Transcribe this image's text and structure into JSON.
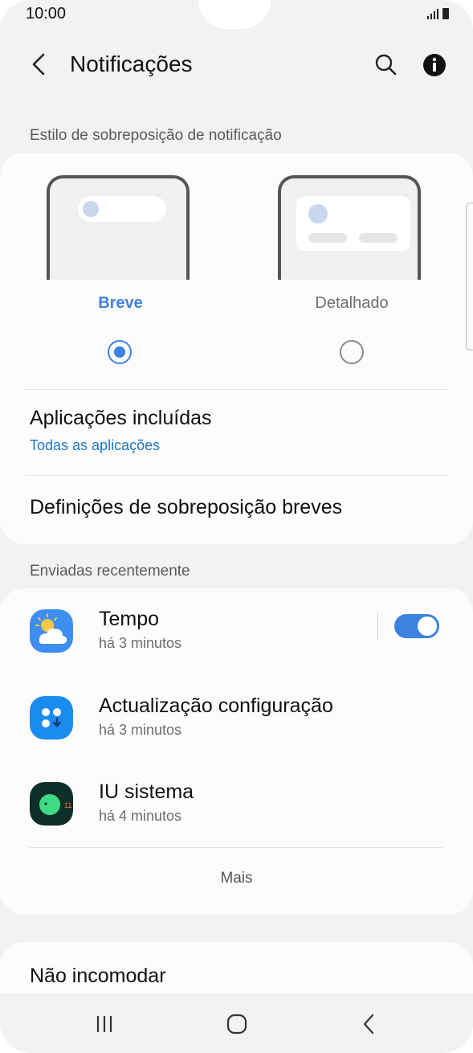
{
  "status_bar": {
    "time": "10:00"
  },
  "header": {
    "title": "Notificações",
    "back_icon": "back-arrow-icon",
    "search_icon": "search-icon",
    "info_icon": "info-icon"
  },
  "overlay_style": {
    "section_label": "Estilo de sobreposição de notificação",
    "options": [
      {
        "label": "Breve",
        "selected": true,
        "color": "#3e82e0"
      },
      {
        "label": "Detalhado",
        "selected": false,
        "color": "#6e6e6e"
      }
    ]
  },
  "included_apps": {
    "title": "Aplicações incluídas",
    "value": "Todas as aplicações"
  },
  "brief_settings": {
    "title": "Definições de sobreposição breves"
  },
  "recent": {
    "section_label": "Enviadas recentemente",
    "apps": [
      {
        "name": "Tempo",
        "time": "há 3 minutos",
        "icon": "weather-app-icon",
        "toggle_on": true
      },
      {
        "name": "Actualização configuração",
        "time": "há 3 minutos",
        "icon": "config-update-app-icon"
      },
      {
        "name": "IU sistema",
        "time": "há 4 minutos",
        "icon": "system-ui-app-icon"
      }
    ],
    "more_label": "Mais"
  },
  "do_not_disturb": {
    "title": "Não incomodar"
  },
  "colors": {
    "accent": "#3e82e0",
    "link": "#1a76c9",
    "background": "#f2f2f2",
    "card": "#fcfcfc"
  }
}
